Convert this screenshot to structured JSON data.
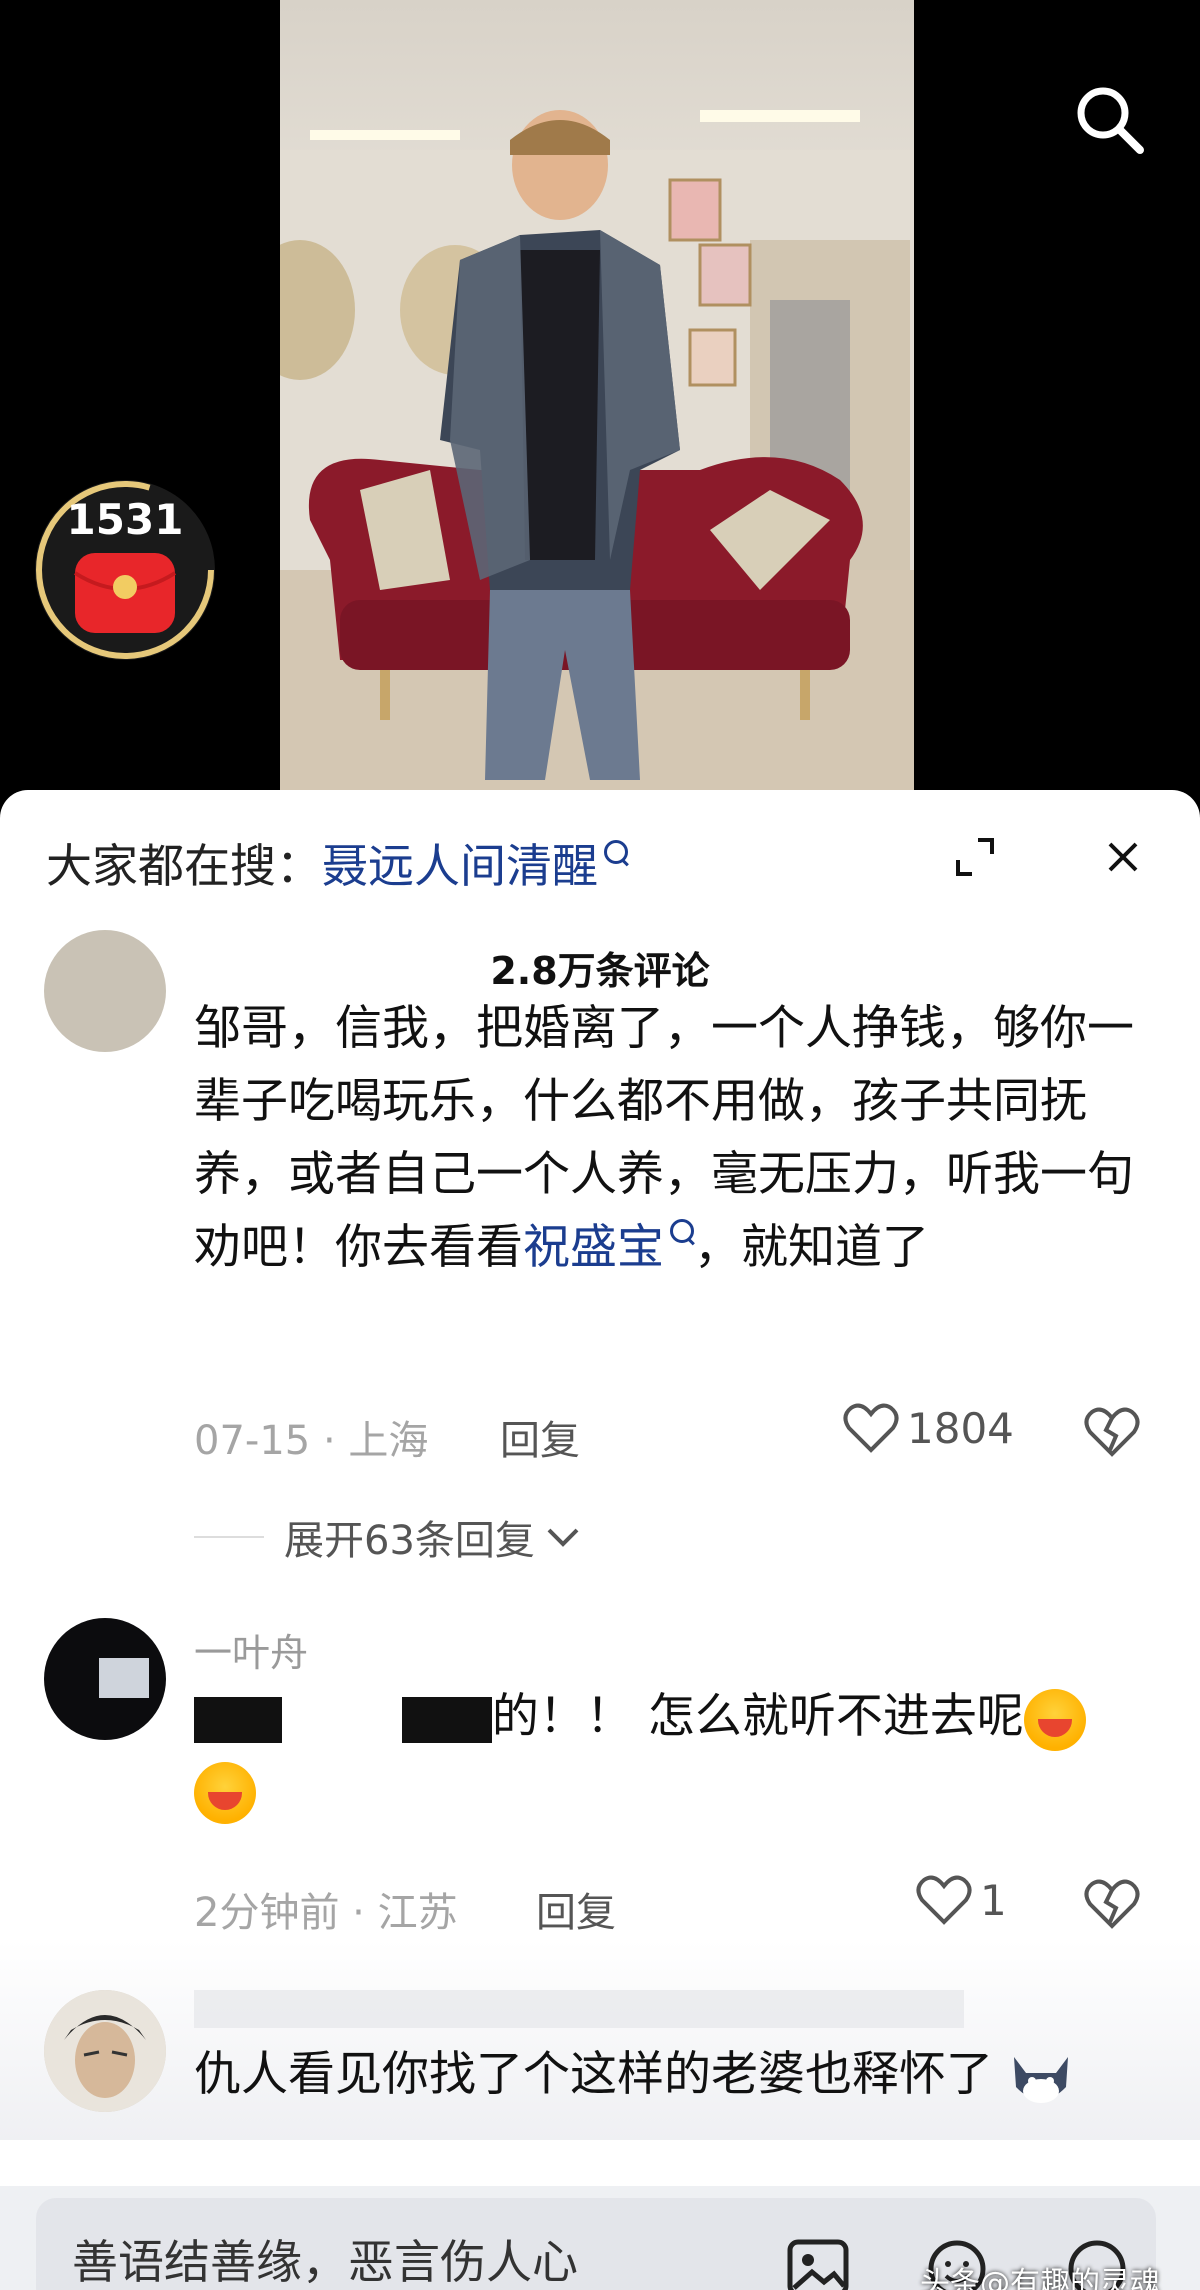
{
  "header": {
    "red_packet_count": "1531"
  },
  "hot_search": {
    "prefix": "大家都在搜：",
    "term": "聂远人间清醒"
  },
  "comments_header": {
    "count_label": "2.8万条评论"
  },
  "comments": [
    {
      "username": "",
      "text_before": "邹哥，信我，把婚离了，一个人挣钱，够你一辈子吃喝玩乐，什么都不用做，孩子共同抚养，或者自己一个人养，毫无压力，听我一句劝吧！你去看看",
      "mention": "祝盛宝",
      "text_after": "，就知道了",
      "date": "07-15",
      "location": "上海",
      "reply_label": "回复",
      "likes": "1804",
      "expand_label": "展开63条回复"
    },
    {
      "username": "一叶舟",
      "text": "的！！ 怎么就听不进去呢",
      "date": "2分钟前",
      "location": "江苏",
      "reply_label": "回复",
      "likes": "1"
    },
    {
      "username": "",
      "text": "仇人看见你找了个这样的老婆也释怀了"
    }
  ],
  "input_bar": {
    "placeholder": "善语结善缘，恶言伤人心"
  },
  "watermark": "头条@有趣的灵魂",
  "colors": {
    "mention": "#1b3d8f",
    "meta_gray": "#a5a5a5",
    "packet_red": "#e8262a",
    "ring_gold": "#e6c87a"
  }
}
